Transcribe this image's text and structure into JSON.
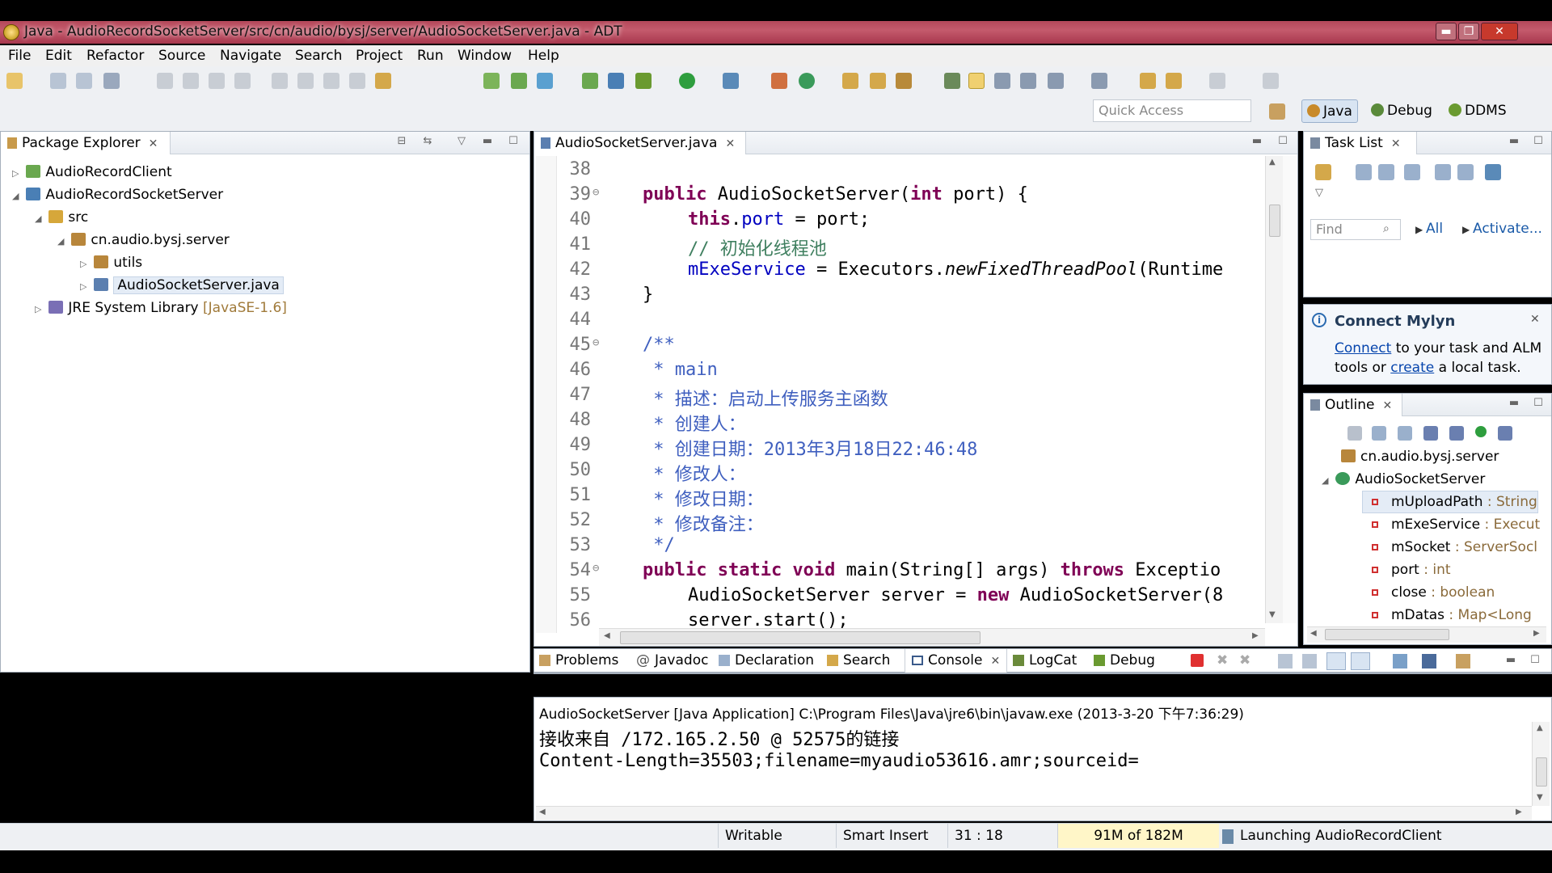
{
  "window": {
    "title": "Java - AudioRecordSocketServer/src/cn/audio/bysj/server/AudioSocketServer.java - ADT",
    "minimize_glyph": "▬",
    "maximize_glyph": "❐",
    "close_glyph": "✕"
  },
  "menu": [
    "File",
    "Edit",
    "Refactor",
    "Source",
    "Navigate",
    "Search",
    "Project",
    "Run",
    "Window",
    "Help"
  ],
  "toolbar": {
    "quick_access_placeholder": "Quick Access",
    "perspectives": [
      {
        "label": "Java",
        "icon": "java-perspective-icon",
        "color": "#c88a2a"
      },
      {
        "label": "Debug",
        "icon": "debug-perspective-icon",
        "color": "#5a8a3a"
      },
      {
        "label": "DDMS",
        "icon": "ddms-perspective-icon",
        "color": "#6a9a30"
      }
    ]
  },
  "package_explorer": {
    "tab_label": "Package Explorer",
    "tree": [
      {
        "label": "AudioRecordClient",
        "twisty": "▷",
        "icon": "android-project-icon",
        "color": "#6aa84f"
      },
      {
        "label": "AudioRecordSocketServer",
        "twisty": "◢",
        "icon": "java-project-icon",
        "color": "#4a7fb5"
      },
      {
        "label": "src",
        "twisty": "◢",
        "icon": "source-folder-icon",
        "color": "#d6a73a"
      },
      {
        "label": "cn.audio.bysj.server",
        "twisty": "◢",
        "icon": "package-icon",
        "color": "#b8863b"
      },
      {
        "label": "utils",
        "twisty": "▷",
        "icon": "package-icon",
        "color": "#b8863b"
      },
      {
        "label": "AudioSocketServer.java",
        "twisty": "▷",
        "icon": "java-file-icon",
        "color": "#5b7fb0"
      },
      {
        "label": "JRE System Library",
        "suffix": "[JavaSE-1.6]",
        "twisty": "▷",
        "icon": "library-icon",
        "color": "#7a6fb5"
      }
    ]
  },
  "editor": {
    "tab_label": "AudioSocketServer.java",
    "line_numbers": [
      "38",
      "39",
      "40",
      "41",
      "42",
      "43",
      "44",
      "45",
      "46",
      "47",
      "48",
      "49",
      "50",
      "51",
      "52",
      "53",
      "54",
      "55",
      "56"
    ],
    "fold_marker": "⊖",
    "code": {
      "l39_public": "public",
      "l39_rest1": " AudioSocketServer(",
      "l39_int": "int",
      "l39_rest2": " port) {",
      "l40_this": "this",
      "l40_dot": ".",
      "l40_port": "port",
      "l40_rest": " = port;",
      "l41": "// 初始化线程池",
      "l42_field": "mExeService",
      "l42_rest1": " = Executors.",
      "l42_method": "newFixedThreadPool",
      "l42_rest2": "(Runtime",
      "l43": "}",
      "l45": "/**",
      "l46": " * main",
      "l47": " * 描述：启动上传服务主函数",
      "l48": " * 创建人：",
      "l49": " * 创建日期：2013年3月18日22:46:48",
      "l50": " * 修改人：",
      "l51": " * 修改日期：",
      "l52": " * 修改备注：",
      "l53": " */",
      "l54_kw": "public static void",
      "l54_rest1": " main(String[] args) ",
      "l54_throws": "throws",
      "l54_rest2": " Exceptio",
      "l55_rest1": "AudioSocketServer server = ",
      "l55_new": "new",
      "l55_rest2": " AudioSocketServer(8",
      "l56": "server.start();"
    }
  },
  "task_list": {
    "tab_label": "Task List",
    "find_placeholder": "Find",
    "all_label": "All",
    "activate_label": "Activate..."
  },
  "mylyn": {
    "title": "Connect Mylyn",
    "connect_link": "Connect",
    "text1": " to your task and ALM",
    "text2": "tools or ",
    "create_link": "create",
    "text3": " a local task."
  },
  "outline": {
    "tab_label": "Outline",
    "package": "cn.audio.bysj.server",
    "class_name": "AudioSocketServer",
    "fields": [
      {
        "name": "mUploadPath",
        "type": " : String"
      },
      {
        "name": "mExeService",
        "type": " : Execut"
      },
      {
        "name": "mSocket",
        "type": " : ServerSocl"
      },
      {
        "name": "port",
        "type": " : int"
      },
      {
        "name": "close",
        "type": " : boolean"
      },
      {
        "name": "mDatas",
        "type": " : Map<Long"
      }
    ]
  },
  "bottom_tabs": [
    {
      "label": "Problems",
      "icon": "problems-icon",
      "active": false
    },
    {
      "label": "Javadoc",
      "icon": "javadoc-icon",
      "active": false
    },
    {
      "label": "Declaration",
      "icon": "declaration-icon",
      "active": false
    },
    {
      "label": "Search",
      "icon": "search-icon",
      "active": false
    },
    {
      "label": "Console",
      "icon": "console-icon",
      "active": true
    },
    {
      "label": "LogCat",
      "icon": "logcat-icon",
      "active": false
    },
    {
      "label": "Debug",
      "icon": "debug-icon",
      "active": false
    }
  ],
  "console": {
    "header": "AudioSocketServer [Java Application] C:\\Program Files\\Java\\jre6\\bin\\javaw.exe (2013-3-20 下午7:36:29)",
    "lines": [
      "接收来自 /172.165.2.50 @ 52575的链接",
      "Content-Length=35503;filename=myaudio53616.amr;sourceid="
    ]
  },
  "status": {
    "writable": "Writable",
    "insert_mode": "Smart Insert",
    "position": "31 : 18",
    "heap": "91M of 182M",
    "progress": "Launching AudioRecordClient"
  },
  "colors": {
    "title_bar": "#b4485a",
    "keyword": "#7f0055",
    "field": "#0000c0",
    "comment": "#3f7f5f",
    "javadoc": "#3f5fbf",
    "terminate": "#e03030"
  }
}
